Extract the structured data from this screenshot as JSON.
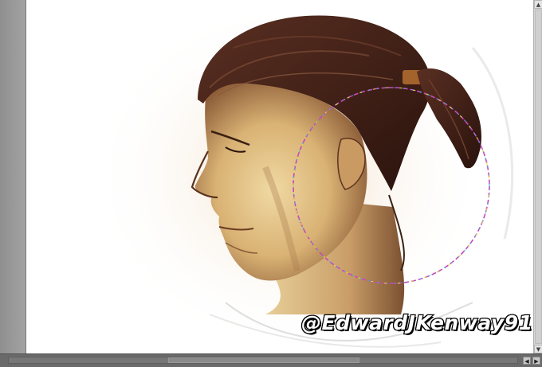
{
  "app": {
    "canvas_background": "#ffffff",
    "workspace_color": "#9c9c9c"
  },
  "artwork": {
    "subject": "profile-portrait-man-ponytail",
    "watermark": "@EdwardJKenway91",
    "hair_color": "#3b1e16",
    "skin_color": "#e3c48a",
    "shadow_color": "#7a4a2a"
  },
  "brush_cursor": {
    "shape": "circle-brush-cursor",
    "colors": [
      "#e84ad8",
      "#32b6e6",
      "#e5e23a"
    ]
  },
  "scrollbars": {
    "vertical": {
      "up_glyph": "▲",
      "down_glyph": "▼"
    },
    "horizontal": {
      "left_glyph": "◀",
      "right_glyph": "▶"
    }
  }
}
